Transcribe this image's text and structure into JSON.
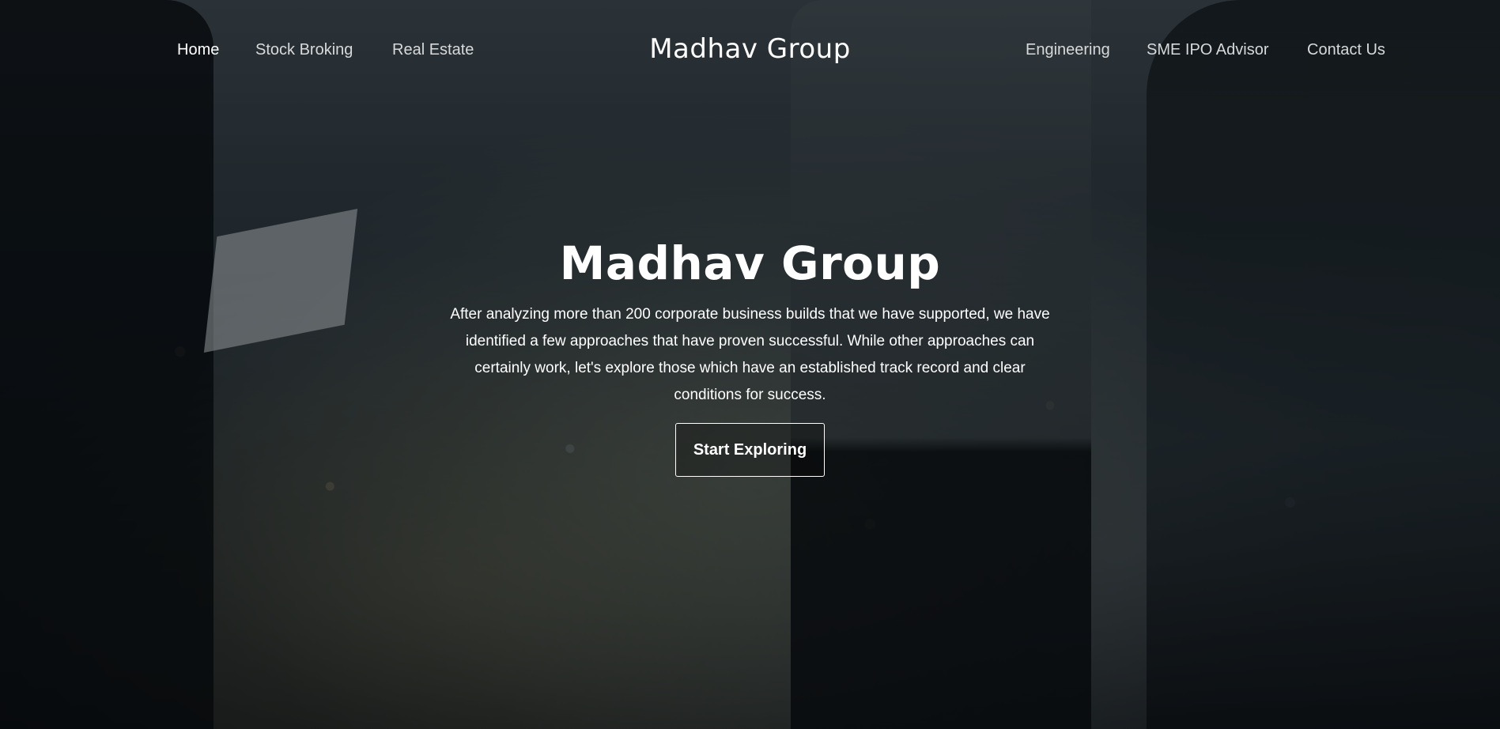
{
  "nav": {
    "left_items": [
      {
        "label": "Home",
        "active": true
      },
      {
        "label": "Stock Broking",
        "active": false
      },
      {
        "label": "Real Estate",
        "active": false
      }
    ],
    "brand": "Madhav Group",
    "right_items": [
      {
        "label": "Engineering"
      },
      {
        "label": "SME IPO Advisor"
      },
      {
        "label": "Contact Us"
      }
    ]
  },
  "hero": {
    "title": "Madhav Group",
    "description": "After analyzing more than 200 corporate business builds that we have supported, we have identified a few approaches that have proven successful. While other approaches can certainly work, let's explore those which have an established track record and clear conditions for success.",
    "cta_label": "Start Exploring",
    "background_image": "business-people-city-skyline-night"
  },
  "colors": {
    "text": "#ffffff",
    "nav_text": "#d7d9da",
    "background": "#0d1216"
  }
}
